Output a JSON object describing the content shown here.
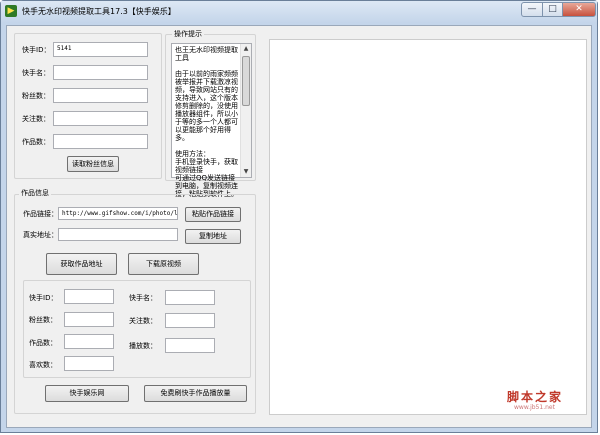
{
  "window": {
    "title": "快手无水印视频提取工具17.3【快手娱乐】",
    "app_icon": "play-icon",
    "minimize": "—",
    "maximize": "□",
    "close": "✕"
  },
  "user_panel": {
    "id_label": "快手ID：",
    "id_value": "5141",
    "name_label": "快手名：",
    "fans_label": "粉丝数：",
    "follow_label": "关注数：",
    "works_label": "作品数：",
    "fetch_button": "读取粉丝信息"
  },
  "tips": {
    "title": "操作提示",
    "text": "也王无水印视频提取工具\n\n由于以前的雨家频频被举报并下载激凉视频，导致网站只有的支持进入，这个版本修剪删除的，没使用播放器组件，所以小于等的多一个人都可以更能那个好用得多。\n\n使用方法：\n手机登录快手，获取视频链接\n可通过QQ发送链接到电脑，复制视频连接，粘贴到软件上。"
  },
  "work_info": {
    "title": "作品信息",
    "link_label": "作品链接：",
    "link_value": "http://www.gifshow.com/i/photo/lwx",
    "paste_button": "粘贴作品链接",
    "real_label": "真实地址：",
    "real_value": "",
    "copy_button": "复制地址",
    "get_button": "获取作品地址",
    "download_button": "下载原视频"
  },
  "work_stats": {
    "id_label": "快手ID：",
    "name_label": "快手名：",
    "fans_label": "粉丝数：",
    "follow_label": "关注数：",
    "works_label": "作品数：",
    "plays_label": "播放数：",
    "likes_label": "喜欢数："
  },
  "bottom": {
    "ent_button": "快手娱乐网",
    "free_button": "免费刷快手作品播放量"
  },
  "watermark": {
    "text": "脚本之家",
    "url": "www.jb51.net"
  },
  "colors": {
    "frame": "#c4d5ea",
    "client": "#f0f0f0",
    "close_button": "#c7513d",
    "watermark": "#c0392b"
  }
}
